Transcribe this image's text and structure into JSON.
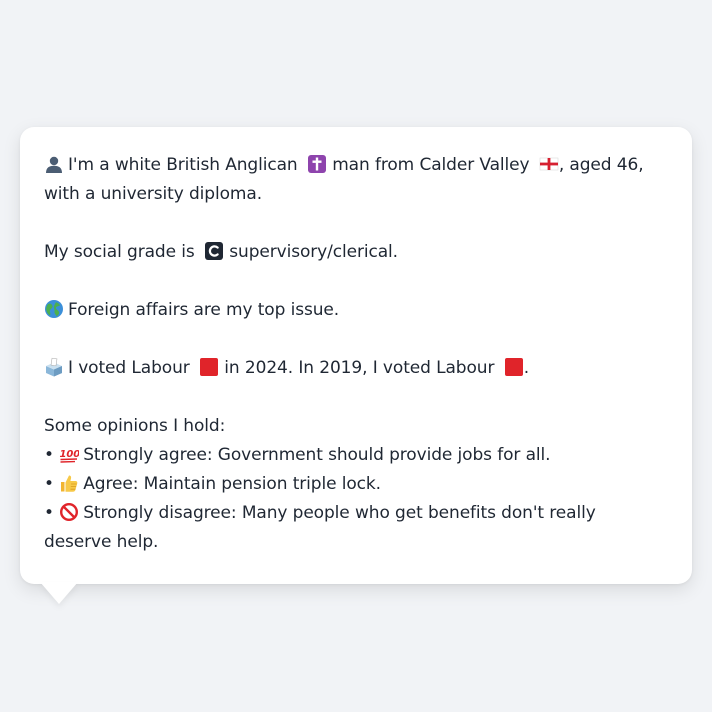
{
  "message": {
    "identity": {
      "part1": "I'm a white British Anglican",
      "part2": "man from Calder Valley",
      "part3": ", aged 46, with a university diploma."
    },
    "social_grade": {
      "prefix": "My social grade is",
      "value": "supervisory/clerical."
    },
    "top_issue": "Foreign affairs are my top issue.",
    "votes": {
      "part1": "I voted Labour",
      "part2": "in 2024. In 2019, I voted Labour",
      "part3": "."
    },
    "opinions": {
      "heading": "Some opinions I hold:",
      "items": [
        {
          "stance": "Strongly agree",
          "text": "Government should provide jobs for all.",
          "icon": "hundred-points-icon"
        },
        {
          "stance": "Agree",
          "text": "Maintain pension triple lock.",
          "icon": "thumbs-up-icon"
        },
        {
          "stance": "Strongly disagree",
          "text": "Many people who get benefits don't really deserve help.",
          "icon": "prohibited-icon"
        }
      ]
    }
  },
  "icons": {
    "person": "person-silhouette-icon",
    "religion": "latin-cross-icon",
    "flag": "england-flag-icon",
    "grade": "letter-c-icon",
    "issue": "globe-icon",
    "vote": "ballot-box-icon",
    "party": "red-square-icon"
  },
  "colors": {
    "background": "#f1f3f6",
    "bubble": "#ffffff",
    "text": "#1f2733",
    "labour_red": "#e0242a"
  }
}
